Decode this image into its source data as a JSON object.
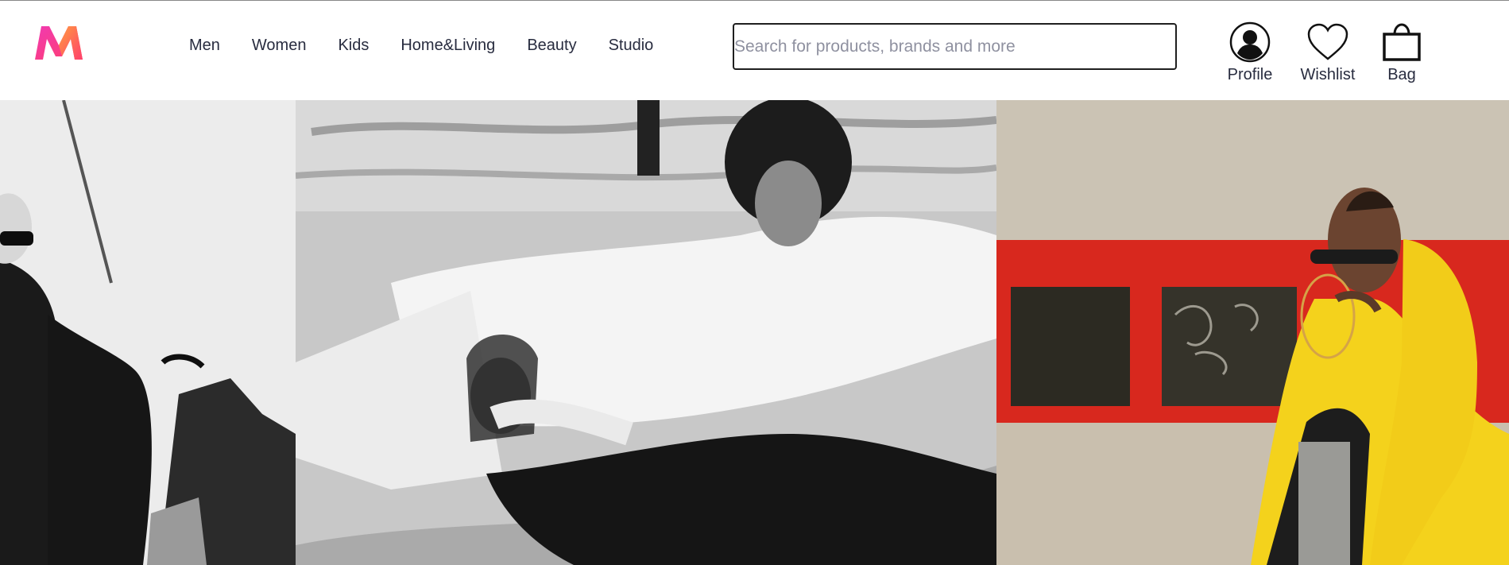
{
  "brand": {
    "name": "Myntra",
    "logo_icon": "myntra-logo-icon",
    "colors": [
      "#ff3f6c",
      "#f13ab1",
      "#ff9c3f"
    ]
  },
  "nav": {
    "items": [
      {
        "label": "Men"
      },
      {
        "label": "Women"
      },
      {
        "label": "Kids"
      },
      {
        "label": "Home&Living"
      },
      {
        "label": "Beauty"
      },
      {
        "label": "Studio"
      }
    ]
  },
  "search": {
    "placeholder": "Search for products, brands and more",
    "value": ""
  },
  "actions": {
    "profile": {
      "label": "Profile",
      "icon": "profile-icon"
    },
    "wishlist": {
      "label": "Wishlist",
      "icon": "heart-icon"
    },
    "bag": {
      "label": "Bag",
      "icon": "bag-icon"
    }
  },
  "banner": {
    "slides": [
      {
        "tone": "monochrome"
      },
      {
        "tone": "monochrome"
      },
      {
        "tone": "color"
      }
    ]
  },
  "theme": {
    "text": "#282c3f",
    "placeholder": "#8f91a0",
    "accent_red": "#e01e1e",
    "accent_yellow": "#f4d21c"
  }
}
